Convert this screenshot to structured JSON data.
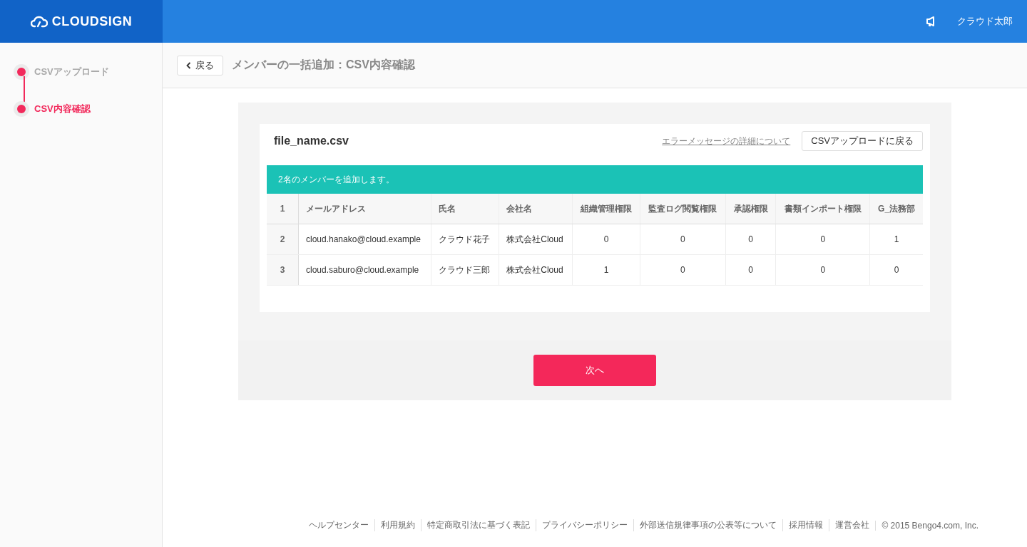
{
  "header": {
    "logo": "CLOUDSIGN",
    "user_name": "クラウド太郎"
  },
  "steps": [
    {
      "label": "CSVアップロード",
      "selected": false
    },
    {
      "label": "CSV内容確認",
      "selected": true
    }
  ],
  "page_header": {
    "back_button": "戻る",
    "title": "メンバーの一括追加：CSV内容確認"
  },
  "card": {
    "file_name": "file_name.csv",
    "error_link": "エラーメッセージの詳細について",
    "back_to_upload_button": "CSVアップロードに戻る",
    "notice": "2名のメンバーを追加します。"
  },
  "table": {
    "header_row": {
      "number": "1",
      "cells": [
        "メールアドレス",
        "氏名",
        "会社名",
        "組織管理権限",
        "監査ログ閲覧権限",
        "承認権限",
        "書類インポート権限",
        "G_法務部"
      ]
    },
    "rows": [
      {
        "number": "2",
        "cells": [
          "cloud.hanako@cloud.example",
          "クラウド花子",
          "株式会社Cloud",
          "0",
          "0",
          "0",
          "0",
          "1"
        ]
      },
      {
        "number": "3",
        "cells": [
          "cloud.saburo@cloud.example",
          "クラウド三郎",
          "株式会社Cloud",
          "1",
          "0",
          "0",
          "0",
          "0"
        ]
      }
    ]
  },
  "next_button": "次へ",
  "footer": {
    "links": [
      "ヘルプセンター",
      "利用規約",
      "特定商取引法に基づく表記",
      "プライバシーポリシー",
      "外部送信規律事項の公表等について",
      "採用情報",
      "運営会社"
    ],
    "copyright": "© 2015 Bengo4.com, Inc."
  }
}
